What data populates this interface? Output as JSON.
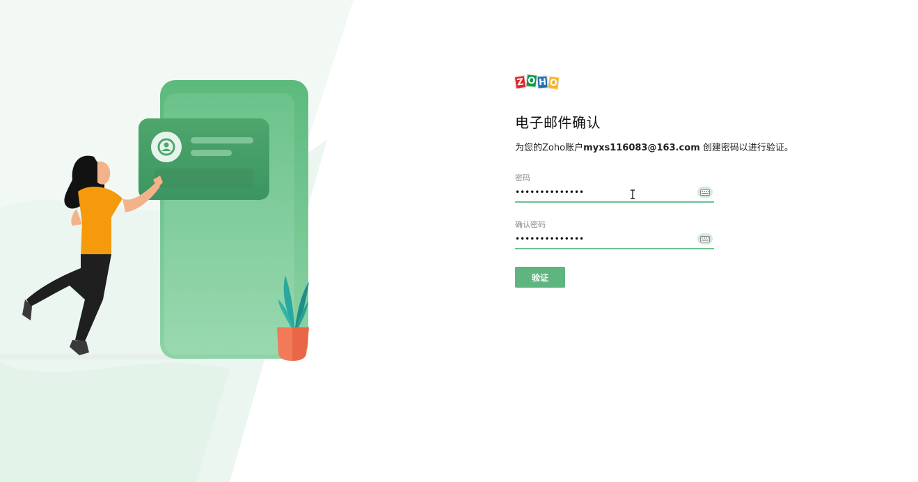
{
  "logo": {
    "letters": [
      "Z",
      "O",
      "H",
      "O"
    ],
    "brand_colors": [
      "#e42527",
      "#089949",
      "#226db4",
      "#f9b21d"
    ]
  },
  "page": {
    "title": "电子邮件确认",
    "description_prefix": "为您的Zoho账户",
    "email": "myxs116083@163.com",
    "description_suffix": " 创建密码以进行验证。"
  },
  "form": {
    "password": {
      "label": "密码",
      "value": "••••••••••••••",
      "toggle_icon": "keyboard-icon"
    },
    "confirm_password": {
      "label": "确认密码",
      "value": "••••••••••••••",
      "toggle_icon": "keyboard-icon"
    },
    "submit_label": "验证"
  },
  "colors": {
    "accent": "#5fb580",
    "underline": "#6dc091",
    "illustration_green": "#4fb173"
  }
}
